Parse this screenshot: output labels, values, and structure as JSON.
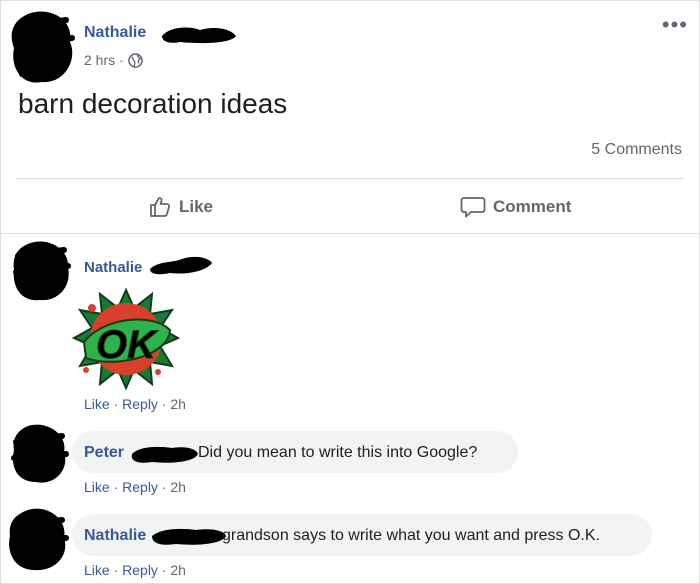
{
  "post": {
    "author": "Nathalie",
    "time": "2 hrs",
    "separator": "·",
    "text": "barn decoration ideas",
    "comments_count": "5 Comments",
    "more_menu": "•••"
  },
  "actions": {
    "like": "Like",
    "comment": "Comment"
  },
  "comments": [
    {
      "author": "Nathalie",
      "sticker_text": "OK",
      "like": "Like",
      "reply": "Reply",
      "time": "2h"
    },
    {
      "author": "Peter",
      "text": "Did you mean to write this into Google?",
      "like": "Like",
      "reply": "Reply",
      "time": "2h"
    },
    {
      "author": "Nathalie",
      "text": "grandson says to write what you want and press O.K.",
      "like": "Like",
      "reply": "Reply",
      "time": "2h"
    }
  ],
  "colors": {
    "link_blue": "#385898",
    "meta_gray": "#606770",
    "bubble_bg": "#f2f3f5",
    "sticker_green": "#2fb24c",
    "sticker_red": "#d9402b"
  },
  "icons": {
    "globe": "globe-icon",
    "like": "thumbs-up-icon",
    "comment": "speech-bubble-icon",
    "more": "more-options-icon"
  }
}
